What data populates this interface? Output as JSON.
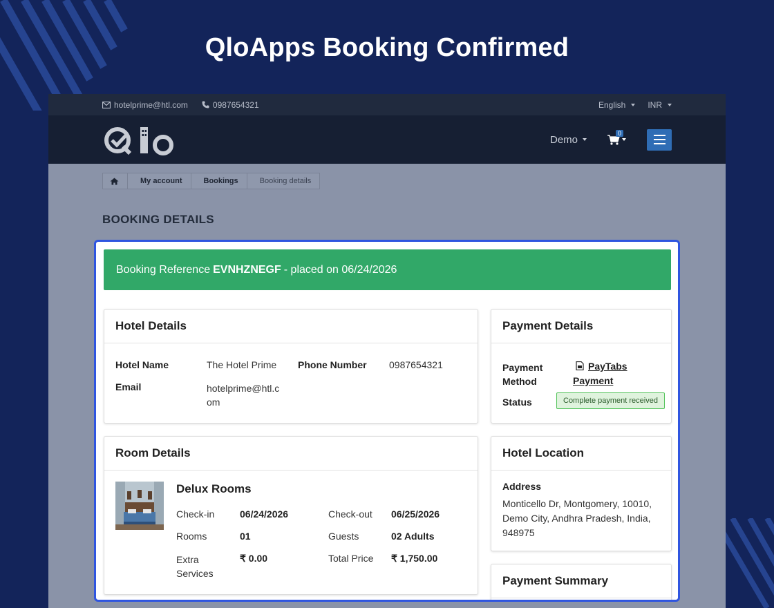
{
  "headline": "QloApps Booking Confirmed",
  "colors": {
    "background": "#13245a",
    "accent": "#2f6db5",
    "success": "#31a868",
    "highlight_border": "#2f55e0"
  },
  "topbar": {
    "email": "hotelprime@htl.com",
    "phone": "0987654321",
    "language": "English",
    "currency": "INR"
  },
  "navbar": {
    "user": "Demo",
    "cart_count": "0"
  },
  "breadcrumb": {
    "items": [
      "My account",
      "Bookings",
      "Booking details"
    ]
  },
  "page_title": "BOOKING DETAILS",
  "alert": {
    "prefix": "Booking Reference",
    "reference": "EVNHZNEGF",
    "suffix": "- placed on 06/24/2026"
  },
  "hotel_details": {
    "title": "Hotel Details",
    "name_label": "Hotel Name",
    "name": "The Hotel Prime",
    "phone_label": "Phone Number",
    "phone": "0987654321",
    "email_label": "Email",
    "email": "hotelprime@htl.com"
  },
  "payment_details": {
    "title": "Payment Details",
    "method_label": "Payment Method",
    "method": "PayTabs Payment",
    "status_label": "Status",
    "status": "Complete payment received"
  },
  "room_details": {
    "title": "Room Details",
    "room_name": "Delux Rooms",
    "checkin_label": "Check-in",
    "checkin": "06/24/2026",
    "checkout_label": "Check-out",
    "checkout": "06/25/2026",
    "rooms_label": "Rooms",
    "rooms": "01",
    "guests_label": "Guests",
    "guests": "02 Adults",
    "extra_label": "Extra Services",
    "extra": "₹ 0.00",
    "total_label": "Total Price",
    "total": "₹ 1,750.00"
  },
  "hotel_location": {
    "title": "Hotel Location",
    "address_label": "Address",
    "address": "Monticello Dr, Montgomery, 10010, Demo City, Andhra Pradesh, India, 948975"
  },
  "payment_summary": {
    "title": "Payment Summary"
  },
  "icons": [
    "envelope-icon",
    "phone-icon",
    "cart-icon",
    "hamburger-icon",
    "home-icon",
    "pdf-icon"
  ]
}
